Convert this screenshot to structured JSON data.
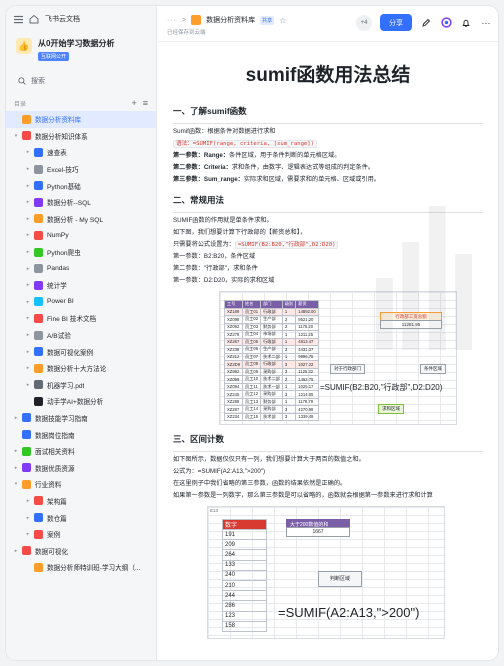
{
  "sidebar": {
    "app_name": "飞书云文档",
    "workspace_title": "从0开始学习数据分析",
    "workspace_badge": "互联网公开",
    "search_placeholder": "搜索",
    "dir_label": "目录",
    "items": [
      {
        "label": "数据分析资料库",
        "level": 0,
        "arrow": "",
        "color": "#ff9d2b",
        "active": true
      },
      {
        "label": "数据分析知识体系",
        "level": 0,
        "arrow": "▾",
        "color": "#f54a45"
      },
      {
        "label": "速查表",
        "level": 1,
        "arrow": "▸",
        "color": "#3370ff"
      },
      {
        "label": "Excel-技巧",
        "level": 1,
        "arrow": "▸",
        "color": "#8f959e"
      },
      {
        "label": "Python基础",
        "level": 1,
        "arrow": "▸",
        "color": "#3370ff"
      },
      {
        "label": "数据分析--SQL",
        "level": 1,
        "arrow": "▸",
        "color": "#7f3bf5"
      },
      {
        "label": "数据分析 - My SQL",
        "level": 1,
        "arrow": "▸",
        "color": "#ff9d2b"
      },
      {
        "label": "NumPy",
        "level": 1,
        "arrow": "▸",
        "color": "#f54a45"
      },
      {
        "label": "Python爬虫",
        "level": 1,
        "arrow": "▸",
        "color": "#34c724"
      },
      {
        "label": "Pandas",
        "level": 1,
        "arrow": "▸",
        "color": "#8f959e"
      },
      {
        "label": "统计学",
        "level": 1,
        "arrow": "▸",
        "color": "#7f3bf5"
      },
      {
        "label": "Power BI",
        "level": 1,
        "arrow": "▸",
        "color": "#14c0ff"
      },
      {
        "label": "Fine BI 技术文档",
        "level": 1,
        "arrow": "▸",
        "color": "#f54a45"
      },
      {
        "label": "A/B试验",
        "level": 1,
        "arrow": "▸",
        "color": "#8f959e"
      },
      {
        "label": "数据可视化案例",
        "level": 1,
        "arrow": "▸",
        "color": "#3370ff"
      },
      {
        "label": "数据分析十大方法论",
        "level": 1,
        "arrow": "▸",
        "color": "#ff9d2b"
      },
      {
        "label": "机器学习.pdf",
        "level": 1,
        "arrow": "▸",
        "color": "#646a73"
      },
      {
        "label": "动手学AI+数据分析",
        "level": 1,
        "arrow": "",
        "color": "#1f2329"
      },
      {
        "label": "数据技能学习指南",
        "level": 0,
        "arrow": "▸",
        "color": "#3370ff"
      },
      {
        "label": "数据岗位指南",
        "level": 0,
        "arrow": "",
        "color": "#3370ff"
      },
      {
        "label": "面试相关资料",
        "level": 0,
        "arrow": "▸",
        "color": "#34c724"
      },
      {
        "label": "数据优质资源",
        "level": 0,
        "arrow": "▸",
        "color": "#7f3bf5"
      },
      {
        "label": "行业资料",
        "level": 0,
        "arrow": "▾",
        "color": "#ff9d2b"
      },
      {
        "label": "架构篇",
        "level": 1,
        "arrow": "▸",
        "color": "#f54a45"
      },
      {
        "label": "数仓篇",
        "level": 1,
        "arrow": "▸",
        "color": "#3370ff"
      },
      {
        "label": "案例",
        "level": 1,
        "arrow": "▸",
        "color": "#f54a45"
      },
      {
        "label": "数据可视化",
        "level": 0,
        "arrow": "▸",
        "color": "#f54a45"
      },
      {
        "label": "数据分析师特训班-学习大纲（...",
        "level": 1,
        "arrow": "",
        "color": "#ff9d2b"
      }
    ]
  },
  "topbar": {
    "crumb_dots": "···",
    "crumb_sep": ">",
    "doc_title": "数据分析资料库",
    "doc_tag": "共享",
    "sub": "已经保存到云端",
    "collab_count": "+4",
    "share_label": "分享"
  },
  "doc": {
    "title": "sumif函数用法总结",
    "s1_heading": "一、了解sumif函数",
    "s1_intro": "Sumif函数：根据条件对数据进行求和",
    "s1_syntax_label": "语法：",
    "s1_syntax": "=SUMIF(range, criteria, [sum_range])",
    "s1_p1_b": "第一参数：Range：",
    "s1_p1": "条件区域，用于条件判断的单元格区域。",
    "s1_p2_b": "第二参数：Criteria：",
    "s1_p2": "求和条件，由数字、逻辑表达式等组成的判定条件。",
    "s1_p3_b": "第三参数：Sum_range：",
    "s1_p3": "实际求和区域，需要求和的单元格、区域或引用。",
    "s2_heading": "二、常规用法",
    "s2_p1": "SUMIF函数的作用就是单条件求和。",
    "s2_p2": "如下图，我们想要计算下行政部的【薪资总和】，",
    "s2_p3": "只需要将公式设置为：",
    "s2_formula": "=SUMIF(B2:B20,\"行政部\",D2:D20)",
    "s2_p4": "第一参数：B2:B20，条件区域",
    "s2_p5": "第二参数：\"行政部\"，求和条件",
    "s2_p6": "第一参数：D2:D20，实际的求和区域",
    "img1": {
      "headers": [
        "工号",
        "姓名",
        "部门",
        "级别",
        "薪资"
      ],
      "rows": [
        [
          "XZ189",
          "员工01",
          "行政部",
          "1",
          "14892.00"
        ],
        [
          "XZ098",
          "员工02",
          "生产部",
          "2",
          "9521.20"
        ],
        [
          "XZ092",
          "员工03",
          "财务部",
          "2",
          "1175.20"
        ],
        [
          "XZ278",
          "员工04",
          "市场部",
          "1",
          "1211.25"
        ],
        [
          "XZ267",
          "员工05",
          "行政部",
          "1",
          "4813.47"
        ],
        [
          "XZ238",
          "员工06",
          "生产部",
          "3",
          "4431.37"
        ],
        [
          "XZ212",
          "员工07",
          "技术二部",
          "1",
          "9996.75"
        ],
        [
          "XZ2D9",
          "员工08",
          "行政部",
          "3",
          "1027.22"
        ],
        [
          "XZ992",
          "员工09",
          "采购部",
          "3",
          "1125.32"
        ],
        [
          "XZ099",
          "员工10",
          "技术二部",
          "2",
          "1452.75"
        ],
        [
          "XZ094",
          "员工11",
          "技术一部",
          "1",
          "1025.17"
        ],
        [
          "XZ245",
          "员工12",
          "采购部",
          "3",
          "1214.05"
        ],
        [
          "XZ288",
          "员工13",
          "财务部",
          "1",
          "1178.79"
        ],
        [
          "XZ287",
          "员工14",
          "采购部",
          "3",
          "4270.98"
        ],
        [
          "XZ234",
          "员工15",
          "技术部",
          "3",
          "1339.49"
        ]
      ],
      "result_title": "行政部工资总额",
      "result_value": "11281.95",
      "note_left": "对于行政部门",
      "note_right": "条件区域",
      "formula": "=SUMIF(B2:B20,\"行政部\",D2:D20)",
      "note_bottom": "求和区域"
    },
    "s3_heading": "三、区间计数",
    "s3_p1": "如下图所示，数据仅仅只有一列，我们想要计算大于两百的数值之和。",
    "s3_p2": "公式为：=SUMIF(A2:A13,\">200\")",
    "s3_p3": "在这里例子中我们省略的第三参数，函数的结果依然是正确的。",
    "s3_p4": "如果第一参数是一列数字，那么第三参数是可以省略的，函数就会根据第一参数来进行求和计算",
    "img2": {
      "cell_ref": "E13",
      "col_header": "数字",
      "values": [
        "191",
        "209",
        "264",
        "133",
        "240",
        "210",
        "244",
        "286",
        "123",
        "158"
      ],
      "result_title": "大于200数值的和",
      "result_value": "1667",
      "note": "判断区域",
      "formula": "=SUMIF(A2:A13,\">200\")"
    }
  }
}
